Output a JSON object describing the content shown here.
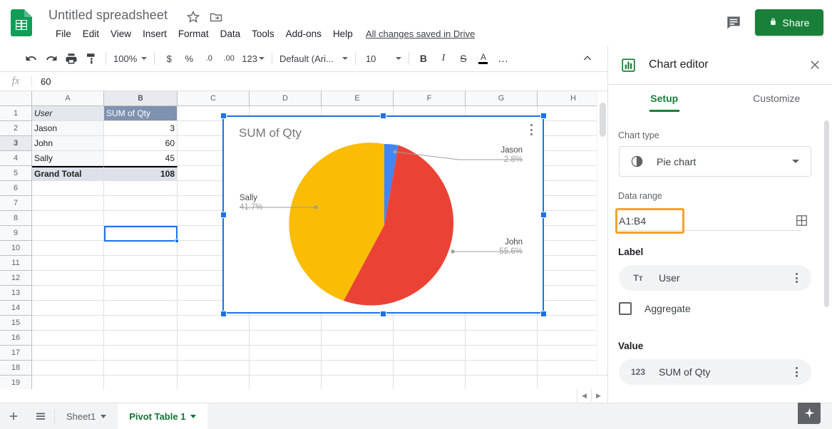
{
  "app": {
    "doc_title": "Untitled spreadsheet",
    "saved_status": "All changes saved in Drive",
    "share_label": "Share"
  },
  "menus": [
    "File",
    "Edit",
    "View",
    "Insert",
    "Format",
    "Data",
    "Tools",
    "Add-ons",
    "Help"
  ],
  "toolbar": {
    "zoom": "100%",
    "font": "Default (Ari...",
    "font_size": "10",
    "number_format": "123",
    "currency": "$",
    "percent": "%",
    "dec_dec": ".0",
    "inc_dec": ".00",
    "bold": "B",
    "italic": "I",
    "strike": "S",
    "text_color": "A",
    "more": "…"
  },
  "formula_bar": {
    "fx": "fx",
    "value": "60"
  },
  "grid": {
    "columns": [
      "A",
      "B",
      "C",
      "D",
      "E",
      "F",
      "G",
      "H"
    ],
    "selected_column": "B",
    "rows": [
      "1",
      "2",
      "3",
      "4",
      "5",
      "6",
      "7",
      "8",
      "9",
      "10",
      "11",
      "12",
      "13",
      "14",
      "15",
      "16",
      "17",
      "18",
      "19"
    ],
    "selected_row": "3",
    "data": [
      {
        "a": "User",
        "b": "SUM of Qty"
      },
      {
        "a": "Jason",
        "b": "3"
      },
      {
        "a": "John",
        "b": "60"
      },
      {
        "a": "Sally",
        "b": "45"
      },
      {
        "a": "Grand Total",
        "b": "108"
      }
    ]
  },
  "chart": {
    "title": "SUM of Qty",
    "menu_icon": "three-dots-icon"
  },
  "chart_data": {
    "type": "pie",
    "title": "SUM of Qty",
    "categories": [
      "Jason",
      "John",
      "Sally"
    ],
    "values": [
      3,
      60,
      45
    ],
    "percentages": [
      "2.8%",
      "55.6%",
      "41.7%"
    ],
    "total": 108,
    "colors": [
      "#4285F4",
      "#EA4335",
      "#FBBC04"
    ],
    "legend": "labeled",
    "labels": [
      {
        "name": "Jason",
        "percent": "2.8%"
      },
      {
        "name": "John",
        "percent": "55.6%"
      },
      {
        "name": "Sally",
        "percent": "41.7%"
      }
    ]
  },
  "panel": {
    "title": "Chart editor",
    "tabs": [
      {
        "label": "Setup",
        "active": true
      },
      {
        "label": "Customize",
        "active": false
      }
    ],
    "chart_type_label": "Chart type",
    "chart_type_value": "Pie chart",
    "data_range_label": "Data range",
    "data_range_value": "A1:B4",
    "label_label": "Label",
    "label_value": "User",
    "label_icon": "Tт",
    "aggregate_label": "Aggregate",
    "value_label": "Value",
    "value_value": "SUM of Qty",
    "value_icon": "123",
    "highlight_color": "#F2A42B"
  },
  "bottom": {
    "add_sheet": "+",
    "all_sheets": "☰",
    "tabs": [
      {
        "label": "Sheet1",
        "active": false
      },
      {
        "label": "Pivot Table 1",
        "active": true
      }
    ],
    "explore": "explore-icon"
  }
}
